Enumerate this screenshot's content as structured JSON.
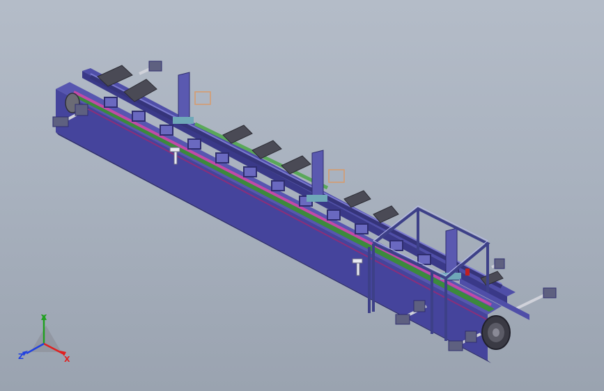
{
  "viewport": {
    "background_top": "#b4bcc8",
    "background_bottom": "#9aa3b0"
  },
  "model": {
    "frame_color": "#4b4a9a",
    "frame_dark": "#2e2d6e",
    "chain_color": "#b0409a",
    "guide_color": "#3c8a3c",
    "plate_color": "#4a4a55",
    "support_frame_color": "#5a5fa0",
    "bracket_color": "#d89a6a",
    "highlight_color": "#e0e2ff"
  },
  "triad": {
    "x_label": "X",
    "y_label": "Y",
    "z_label": "Z",
    "x_color": "#e02020",
    "y_color": "#20a020",
    "z_color": "#2040e0"
  }
}
